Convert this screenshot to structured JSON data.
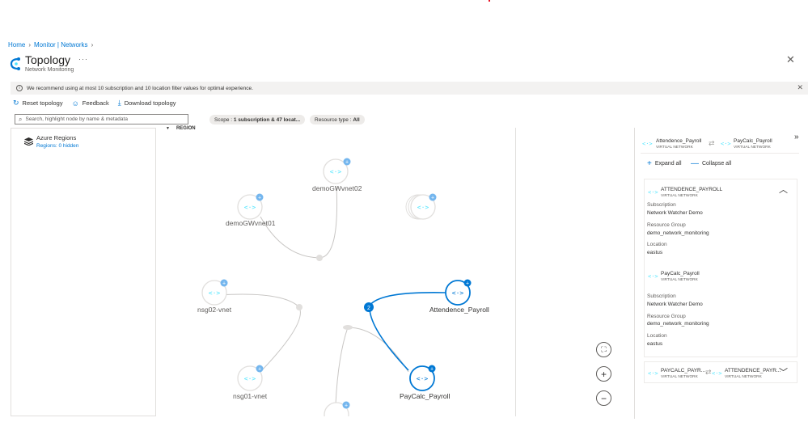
{
  "breadcrumb": {
    "home": "Home",
    "monitor": "Monitor | Networks"
  },
  "header": {
    "title": "Topology",
    "subtitle": "Network Monitoring",
    "more": "···",
    "close": "✕"
  },
  "info_bar": {
    "text": "We recommend using at most 10 subscription and 10 location filter values for optimal experience."
  },
  "toolbar": {
    "reset": "Reset topology",
    "feedback": "Feedback",
    "download": "Download topology"
  },
  "search": {
    "placeholder": "Search, highlight node by name & metadata"
  },
  "filters": {
    "scope_label": "Scope : ",
    "scope_value": "1 subscription & 47 locat...",
    "type_label": "Resource type : ",
    "type_value": "All"
  },
  "left_panel": {
    "title": "Azure Regions",
    "subtitle": "Regions: 0 hidden"
  },
  "canvas": {
    "region_label": "REGION",
    "nodes": {
      "demoGWvnet02": "demoGWvnet02",
      "demoGWvnet01": "demoGWvnet01",
      "nsg02": "nsg02-vnet",
      "nsg01": "nsg01-vnet",
      "attendence": "Attendence_Payroll",
      "paycalc": "PayCalc_Payroll"
    },
    "edge_badge": "2"
  },
  "zoom": {
    "fit": "⛶",
    "in": "+",
    "out": "−"
  },
  "right_panel": {
    "hdr_from": "Attendence_Payroll",
    "hdr_to": "PayCalc_Payroll",
    "hdr_sub": "VIRTUAL NETWORK",
    "expand_all": "Expand all",
    "collapse_all": "Collapse all",
    "card1": {
      "title": "ATTENDENCE_PAYROLL",
      "sub": "VIRTUAL NETWORK",
      "sub_k": "Subscription",
      "sub_v": "Network Watcher Demo",
      "rg_k": "Resource Group",
      "rg_v": "demo_network_monitoring",
      "loc_k": "Location",
      "loc_v": "eastus",
      "title2": "PayCalc_Payroll",
      "sub2": "VIRTUAL NETWORK",
      "sub_v2": "Network Watcher Demo",
      "rg_v2": "demo_network_monitoring",
      "loc_v2": "eastus"
    },
    "card2": {
      "from": "PAYCALC_PAYR...",
      "to": "ATTENDENCE_PAYR...",
      "sub": "VIRTUAL NETWORK"
    }
  },
  "colors": {
    "accent": "#0078d4",
    "node_blue": "#0078d4",
    "vnet_icon": "#50e6ff",
    "edge_grey": "#c8c6c4"
  }
}
